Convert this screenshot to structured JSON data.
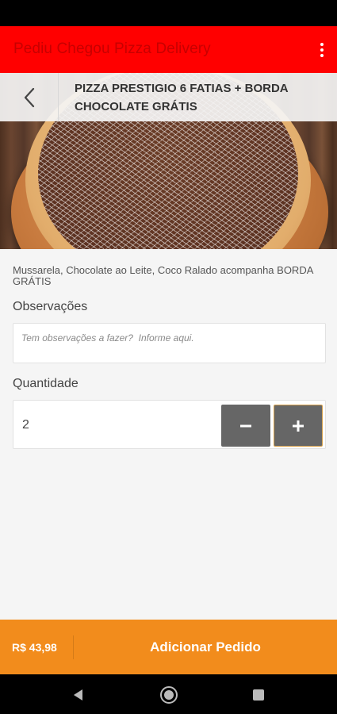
{
  "app": {
    "title": "Pediu Chegou Pizza Delivery"
  },
  "product": {
    "title": "PIZZA PRESTIGIO 6 FATIAS + BORDA CHOCOLATE GRÁTIS",
    "description": "Mussarela, Chocolate ao Leite, Coco Ralado acompanha BORDA GRÁTIS"
  },
  "observations": {
    "label": "Observações",
    "placeholder": "Tem observações a fazer?  Informe aqui.",
    "value": ""
  },
  "quantity": {
    "label": "Quantidade",
    "value": "2",
    "minus_label": "−",
    "plus_label": "+"
  },
  "footer": {
    "price": "R$ 43,98",
    "add_label": "Adicionar Pedido"
  },
  "colors": {
    "app_bar": "#ff0000",
    "accent": "#f28c1c",
    "stepper": "#666666"
  },
  "icons": {
    "menu": "overflow-menu-icon",
    "back": "back-arrow-icon",
    "nav_back": "nav-back-icon",
    "nav_home": "nav-home-icon",
    "nav_recents": "nav-recents-icon"
  }
}
